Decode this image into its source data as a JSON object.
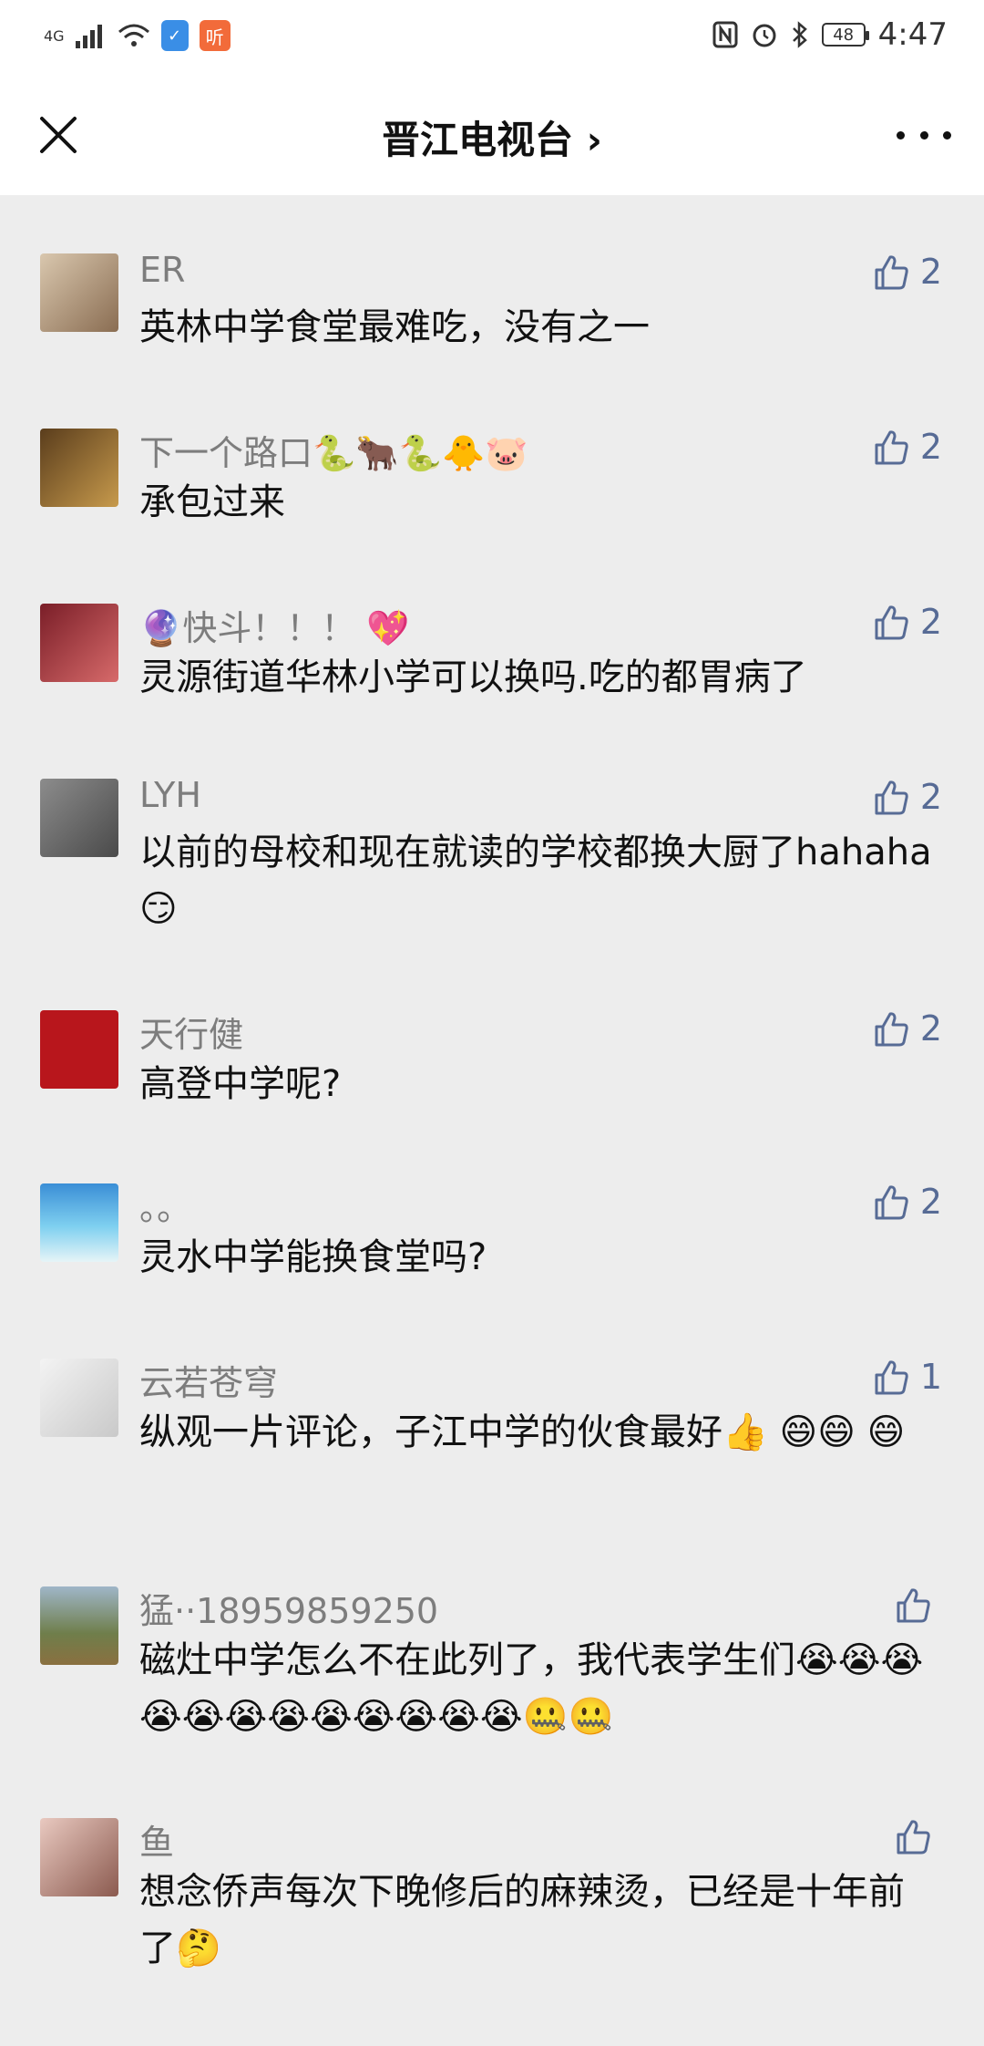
{
  "status_bar": {
    "network": "4G",
    "listen_badge": "听",
    "battery": "48",
    "time": "4:47"
  },
  "nav": {
    "title": "晋江电视台 ›"
  },
  "comments": [
    {
      "nick": "ER",
      "text": "英林中学食堂最难吃，没有之一",
      "likes": "2"
    },
    {
      "nick": "下一个路口🐍🐂🐍🐥🐷",
      "text": "承包过来",
      "likes": "2"
    },
    {
      "nick": "🔮快斗！！！ 💖",
      "text": "灵源街道华林小学可以换吗.吃的都胃病了",
      "likes": "2"
    },
    {
      "nick": "LYH",
      "text": "以前的母校和现在就读的学校都换大厨了hahaha😏",
      "likes": "2"
    },
    {
      "nick": "天行健",
      "text": "高登中学呢?",
      "likes": "2"
    },
    {
      "nick": "。。",
      "text": "灵水中学能换食堂吗?",
      "likes": "2"
    },
    {
      "nick": "云若苍穹",
      "text": "纵观一片评论，子江中学的伙食最好👍 😄😄 😄",
      "likes": "1"
    },
    {
      "nick": "猛··18959859250",
      "text": "磁灶中学怎么不在此列了，我代表学生们😭😭😭😭😭😭😭😭😭😭😭😭🤐🤐",
      "likes": ""
    },
    {
      "nick": "鱼",
      "text": "想念侨声每次下晚修后的麻辣烫，已经是十年前了🤔",
      "likes": ""
    }
  ],
  "colors": {
    "background": "#ededed",
    "nick": "#7d7d7d",
    "like": "#576b95"
  }
}
